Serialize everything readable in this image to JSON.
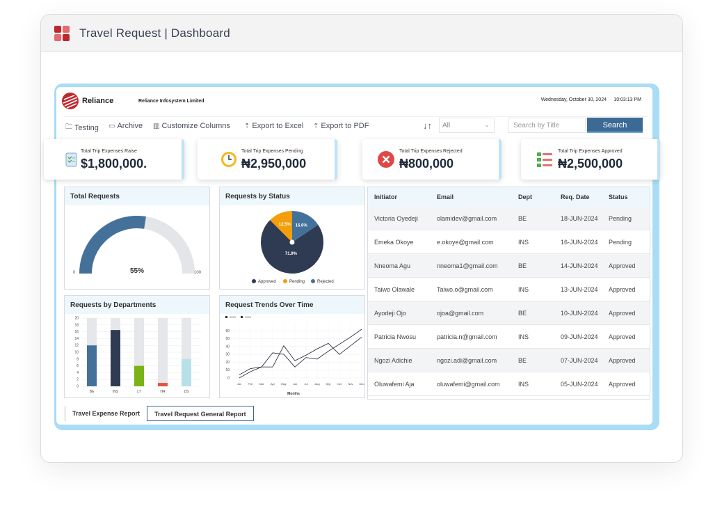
{
  "app": {
    "title": "Travel Request | Dashboard",
    "logo_icon": "app-grid-icon"
  },
  "header": {
    "brand": "Reliance",
    "company": "Reliance Infosystem Limited",
    "date": "Wednesday, October 30, 2024",
    "time": "10:03:13 PM"
  },
  "toolbar": {
    "testing": "Testing",
    "archive": "Archive",
    "customize": "Customize Columns",
    "export_excel": "Export to Excel",
    "export_pdf": "Export to PDF",
    "filter_value": "All",
    "search_placeholder": "Search by Title",
    "search_label": "Search"
  },
  "stats": [
    {
      "label": "Total Trip Expenses Raise",
      "value": "$1,800,000.",
      "icon": "clipboard-check-icon"
    },
    {
      "label": "Total Trip Expenses Pending",
      "value": "₦2,950,000",
      "icon": "clock-icon"
    },
    {
      "label": "Total Trip Expenses Rejected",
      "value": "₦800,000",
      "icon": "reject-x-icon"
    },
    {
      "label": "Total Trip Expenses Approved",
      "value": "₦2,500,000",
      "icon": "checklist-icon"
    }
  ],
  "charts": {
    "total_requests": {
      "title": "Total Requests",
      "min": "0",
      "max": "100",
      "percent_label": "55%"
    },
    "by_status": {
      "title": "Requests  by Status",
      "legend": [
        "Approved",
        "Pending",
        "Rejected"
      ]
    },
    "by_departments": {
      "title": "Requests  by Departments"
    },
    "trends": {
      "title": "Request  Trends Over Time",
      "legend": [
        "2023",
        "2024"
      ],
      "xlabel": "Months"
    }
  },
  "chart_data": [
    {
      "type": "gauge",
      "title": "Total Requests",
      "value": 55,
      "range": [
        0,
        100
      ]
    },
    {
      "type": "pie",
      "title": "Requests  by Status",
      "categories": [
        "Approved",
        "Pending",
        "Rejected"
      ],
      "values": [
        71.9,
        12.5,
        15.6
      ],
      "colors": [
        "#2f3b52",
        "#f59e0b",
        "#44719a"
      ]
    },
    {
      "type": "bar",
      "title": "Requests  by Departments",
      "categories": [
        "BE",
        "INS",
        "LT",
        "HR",
        "DS"
      ],
      "values": [
        12,
        16.5,
        6,
        1,
        8
      ],
      "ylim": [
        0,
        20
      ],
      "colors": [
        "#44719a",
        "#2f3b52",
        "#7ab317",
        "#e8523b",
        "#b8e0ea"
      ],
      "background_color": "#e6e7ea",
      "yticks": [
        "0",
        "2",
        "4",
        "6",
        "8",
        "10",
        "12",
        "14",
        "16",
        "18",
        "20"
      ]
    },
    {
      "type": "line",
      "title": "Request  Trends Over Time",
      "xlabel": "Months",
      "categories": [
        "Jan",
        "Feb",
        "Mar",
        "Apr",
        "May",
        "Jun",
        "Jul",
        "Aug",
        "Sep",
        "Oct",
        "Nov",
        "Dec"
      ],
      "series": [
        {
          "name": "2023",
          "values": [
            4,
            12,
            14,
            14,
            41,
            22,
            29,
            37,
            44,
            30,
            41,
            52
          ]
        },
        {
          "name": "2024",
          "values": [
            0,
            8,
            14,
            32,
            30,
            14,
            26,
            24,
            34,
            43,
            52,
            62
          ]
        }
      ],
      "ylim": [
        0,
        70
      ],
      "yticks": [
        "0",
        "10",
        "20",
        "30",
        "40",
        "50",
        "60"
      ]
    }
  ],
  "table": {
    "headers": [
      "Initiator",
      "Email",
      "Dept",
      "Req. Date",
      "Status"
    ],
    "rows": [
      [
        "Victoria Oyedeji",
        "olamidev@gmail.com",
        "BE",
        "18-JUN-2024",
        "Pending"
      ],
      [
        "Emeka Okoye",
        "e.okoye@gmail.com",
        "INS",
        "16-JUN-2024",
        "Pending"
      ],
      [
        "Nneoma Agu",
        "nneoma1@gmail.com",
        "BE",
        "14-JUN-2024",
        "Approved"
      ],
      [
        "Taiwo Olawale",
        "Taiwo.o@gmail.com",
        "INS",
        "13-JUN-2024",
        "Approved"
      ],
      [
        "Ayodeji Ojo",
        "ojoa@gmail.com",
        "BE",
        "10-JUN-2024",
        "Approved"
      ],
      [
        "Patricia Nwosu",
        "patricia.n@gmail.com",
        "INS",
        "09-JUN-2024",
        "Approved"
      ],
      [
        "Ngozi Adichie",
        "ngozi.adi@gmail.com",
        "BE",
        "07-JUN-2024",
        "Approved"
      ],
      [
        "Oluwafemi  Aja",
        "oluwafemi@gmail.com",
        "INS",
        "05-JUN-2024",
        "Approved"
      ]
    ]
  },
  "reports": {
    "expense": "Travel Expense Report",
    "general": "Travel Request General Report"
  },
  "colors": {
    "accent": "#3c6a94",
    "frame": "#a9dcf5",
    "header_bg": "#eef7fc"
  }
}
